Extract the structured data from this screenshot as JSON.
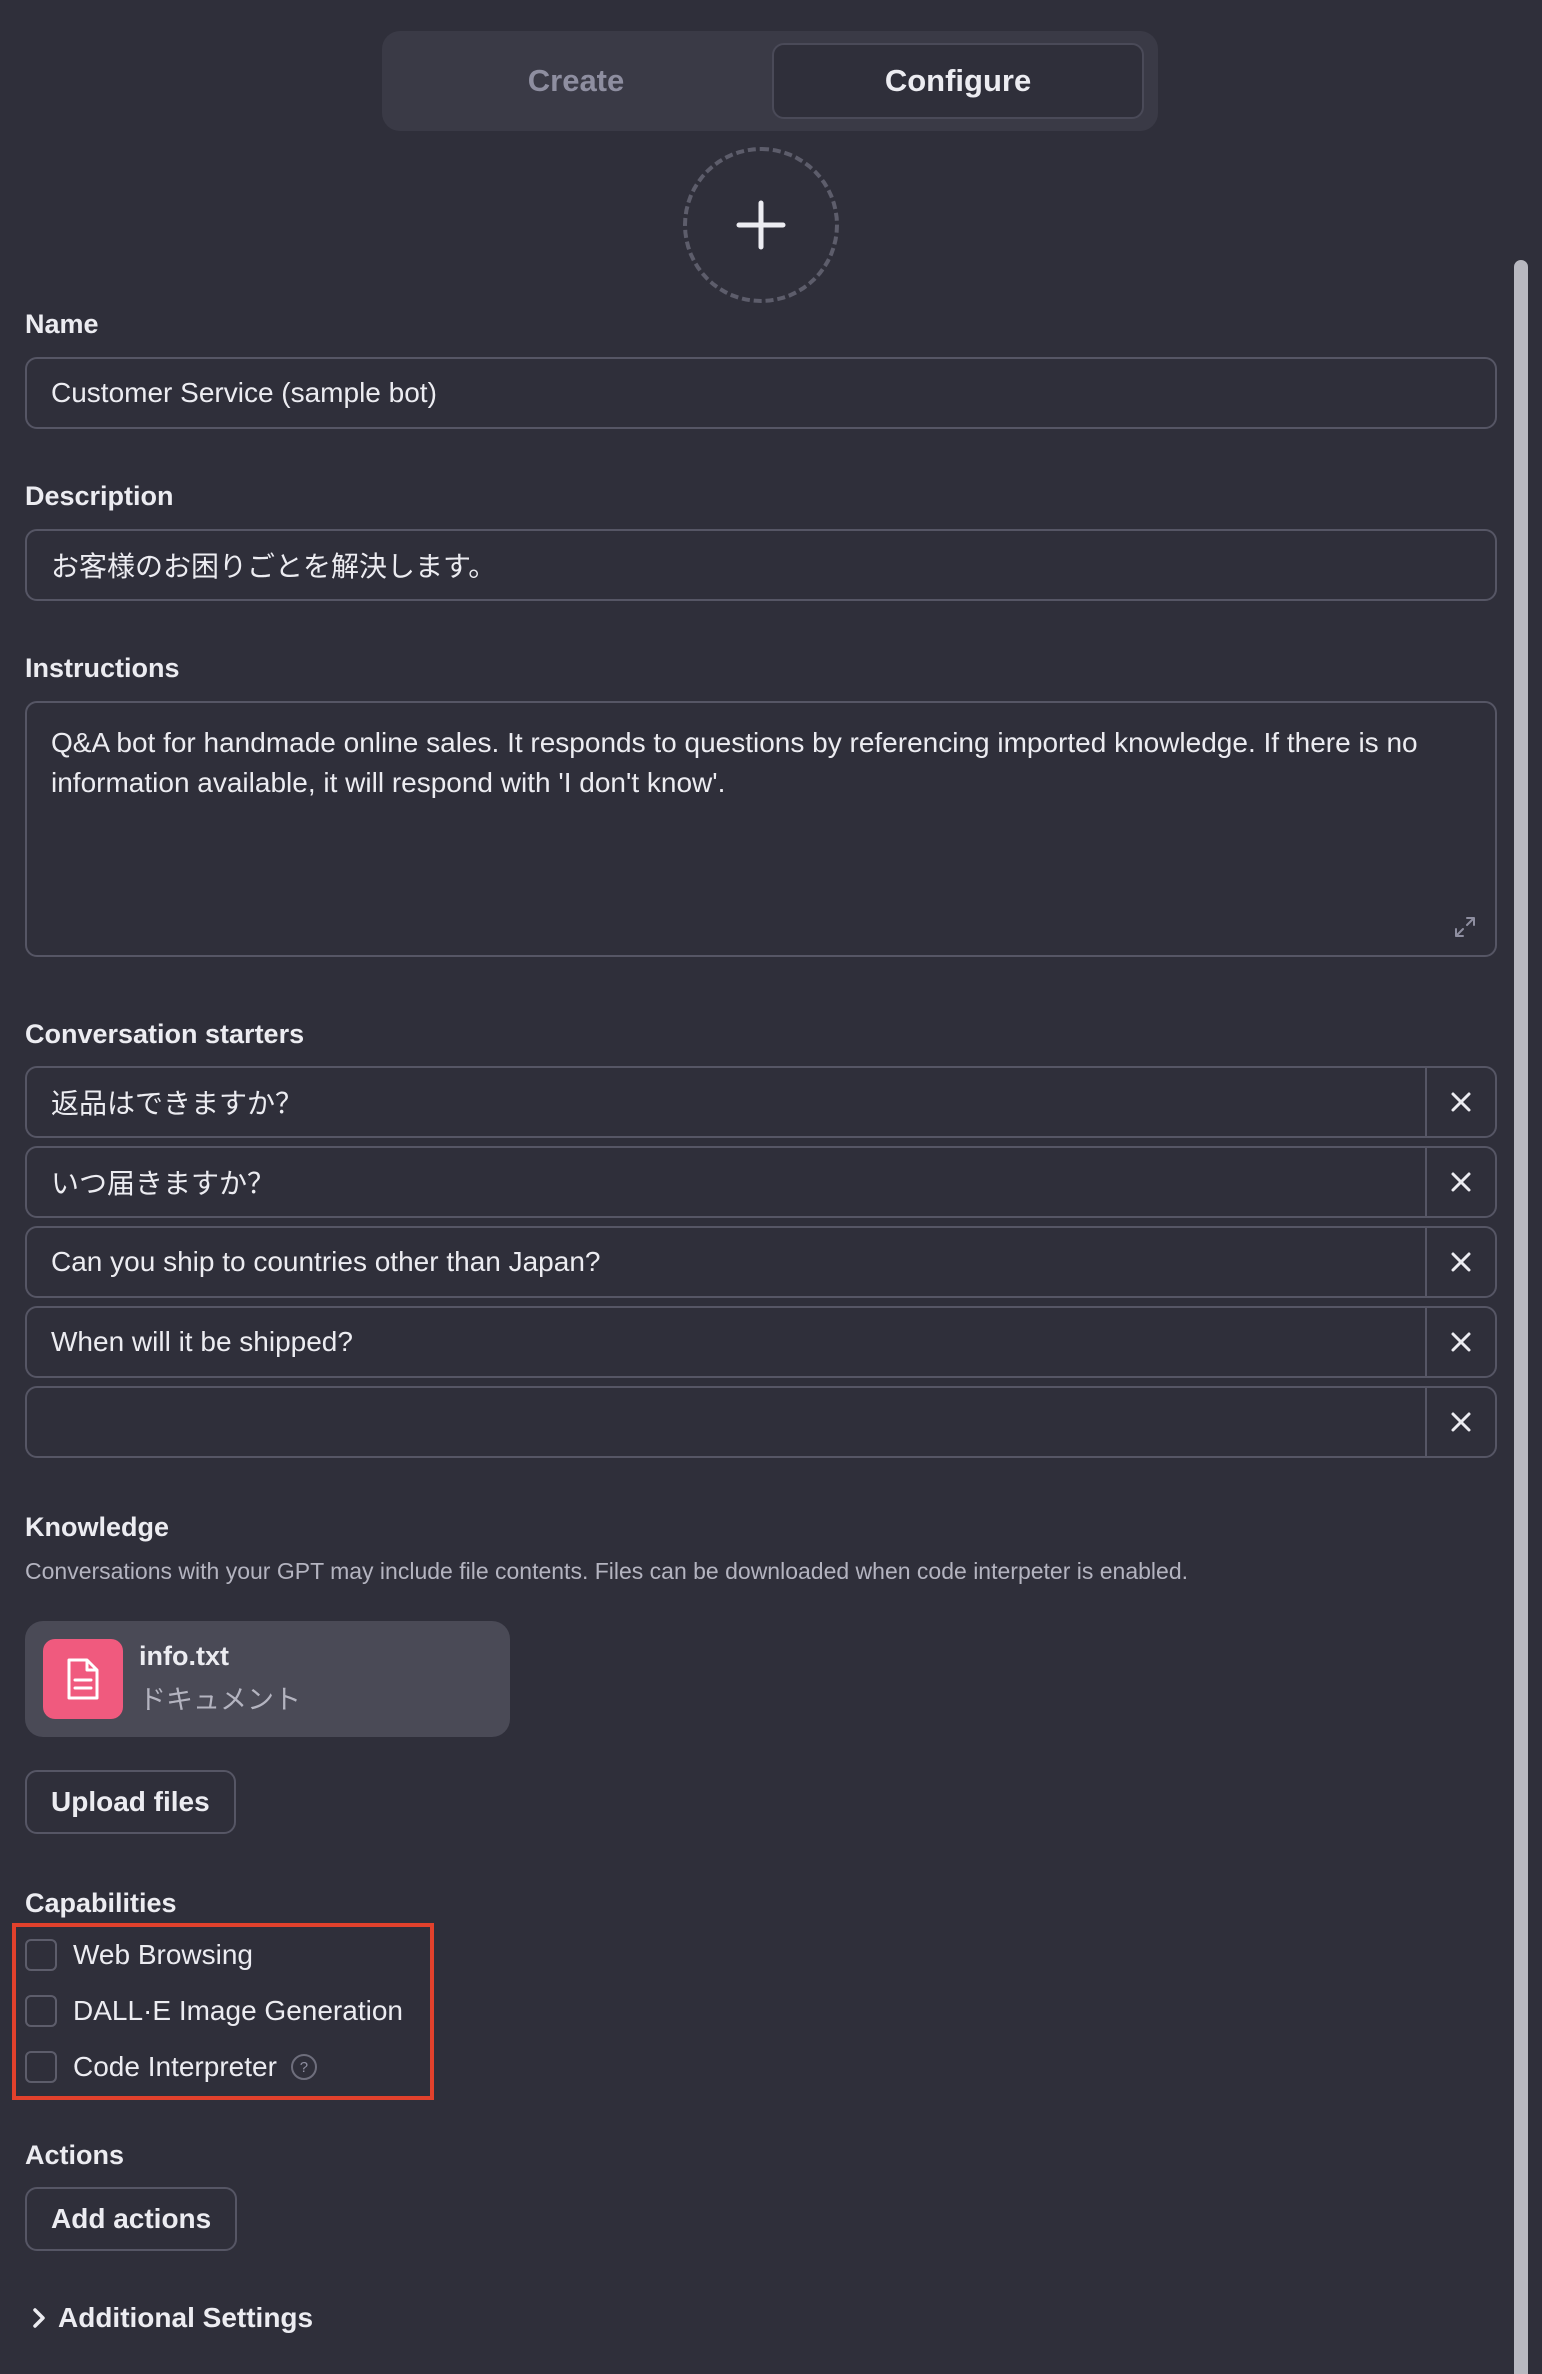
{
  "tabs": {
    "create": "Create",
    "configure": "Configure"
  },
  "name": {
    "label": "Name",
    "value": "Customer Service (sample bot)"
  },
  "description": {
    "label": "Description",
    "value": "お客様のお困りごとを解決します。"
  },
  "instructions": {
    "label": "Instructions",
    "value": "Q&A bot for handmade online sales. It responds to questions by referencing imported knowledge. If there is no information available, it will respond with 'I don't know'."
  },
  "starters": {
    "label": "Conversation starters",
    "items": [
      "返品はできますか？",
      "いつ届きますか？",
      "Can you ship to countries other than Japan?",
      "When will it be shipped?",
      ""
    ]
  },
  "knowledge": {
    "label": "Knowledge",
    "helper": "Conversations with your GPT may include file contents. Files can be downloaded when code interpeter is enabled.",
    "file": {
      "name": "info.txt",
      "type": "ドキュメント",
      "icon": "document-icon",
      "icon_color": "#f05a7e"
    },
    "upload_label": "Upload files"
  },
  "capabilities": {
    "label": "Capabilities",
    "items": [
      {
        "label": "Web Browsing",
        "checked": false
      },
      {
        "label": "DALL·E Image Generation",
        "checked": false
      },
      {
        "label": "Code Interpreter",
        "checked": false
      }
    ],
    "help_glyph": "?",
    "highlight_color": "#e2412c"
  },
  "actions": {
    "label": "Actions",
    "add_label": "Add actions"
  },
  "additional_settings": {
    "label": "Additional Settings"
  }
}
